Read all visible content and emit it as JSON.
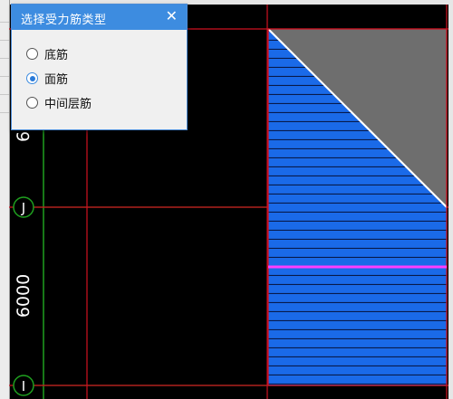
{
  "dialog": {
    "title": "选择受力筋类型",
    "close_glyph": "✕",
    "options": [
      {
        "label": "底筋",
        "checked": false
      },
      {
        "label": "面筋",
        "checked": true
      },
      {
        "label": "中间层筋",
        "checked": false
      }
    ]
  },
  "drawing": {
    "axis_labels": {
      "top": "J",
      "bottom": "I"
    },
    "dimensions": {
      "upper": "6",
      "lower": "6000"
    },
    "colors": {
      "background": "#000000",
      "grid_red": "#d01020",
      "grid_green": "#1fa01f",
      "hatch_fill": "#1a6ae8",
      "hatch_line": "#081a4a",
      "triangle_fill": "#6e6e6e",
      "diagonal": "#ffffff",
      "face_rebar": "#ff3dff"
    }
  }
}
